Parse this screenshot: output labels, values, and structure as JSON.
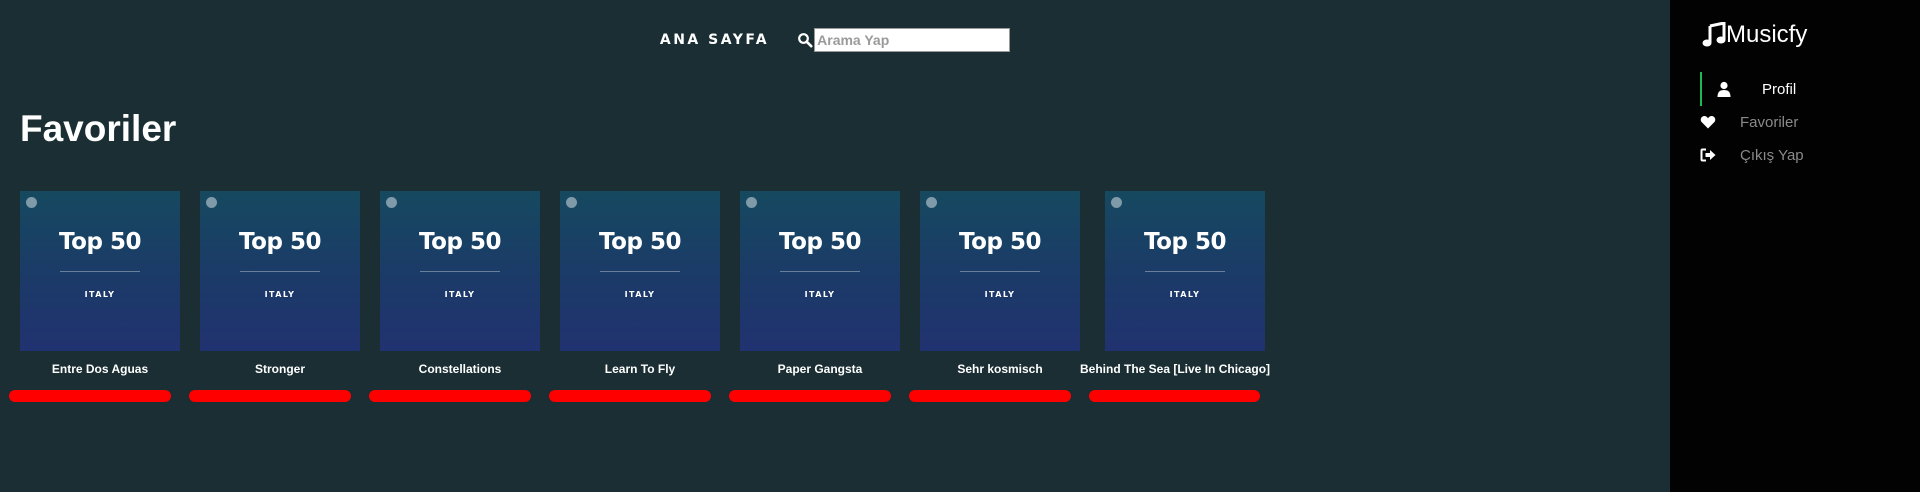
{
  "nav": {
    "home_label": "ANA SAYFA",
    "search_placeholder": "Arama Yap",
    "search_icon": "search-icon"
  },
  "page": {
    "title": "Favoriler"
  },
  "cards": [
    {
      "cover_title": "Top 50",
      "cover_subtitle": "ITALY",
      "song": "Entre Dos Aguas"
    },
    {
      "cover_title": "Top 50",
      "cover_subtitle": "ITALY",
      "song": "Stronger"
    },
    {
      "cover_title": "Top 50",
      "cover_subtitle": "ITALY",
      "song": "Constellations"
    },
    {
      "cover_title": "Top 50",
      "cover_subtitle": "ITALY",
      "song": "Learn To Fly"
    },
    {
      "cover_title": "Top 50",
      "cover_subtitle": "ITALY",
      "song": "Paper Gangsta"
    },
    {
      "cover_title": "Top 50",
      "cover_subtitle": "ITALY",
      "song": "Sehr kosmisch"
    },
    {
      "cover_title": "Top 50",
      "cover_subtitle": "ITALY",
      "song": "Behind The Sea [Live In Chicago]"
    }
  ],
  "sidebar": {
    "brand": "Musicfy",
    "brand_icon": "music-note-icon",
    "items": [
      {
        "label": "Profil",
        "icon": "user-icon",
        "active": true
      },
      {
        "label": "Favoriler",
        "icon": "heart-icon",
        "active": false
      },
      {
        "label": "Çıkış Yap",
        "icon": "sign-out-icon",
        "active": false
      }
    ]
  },
  "colors": {
    "background": "#1a2e33",
    "sidebar": "#020202",
    "active_accent": "#1db954",
    "remove_bar": "#ff0000"
  }
}
